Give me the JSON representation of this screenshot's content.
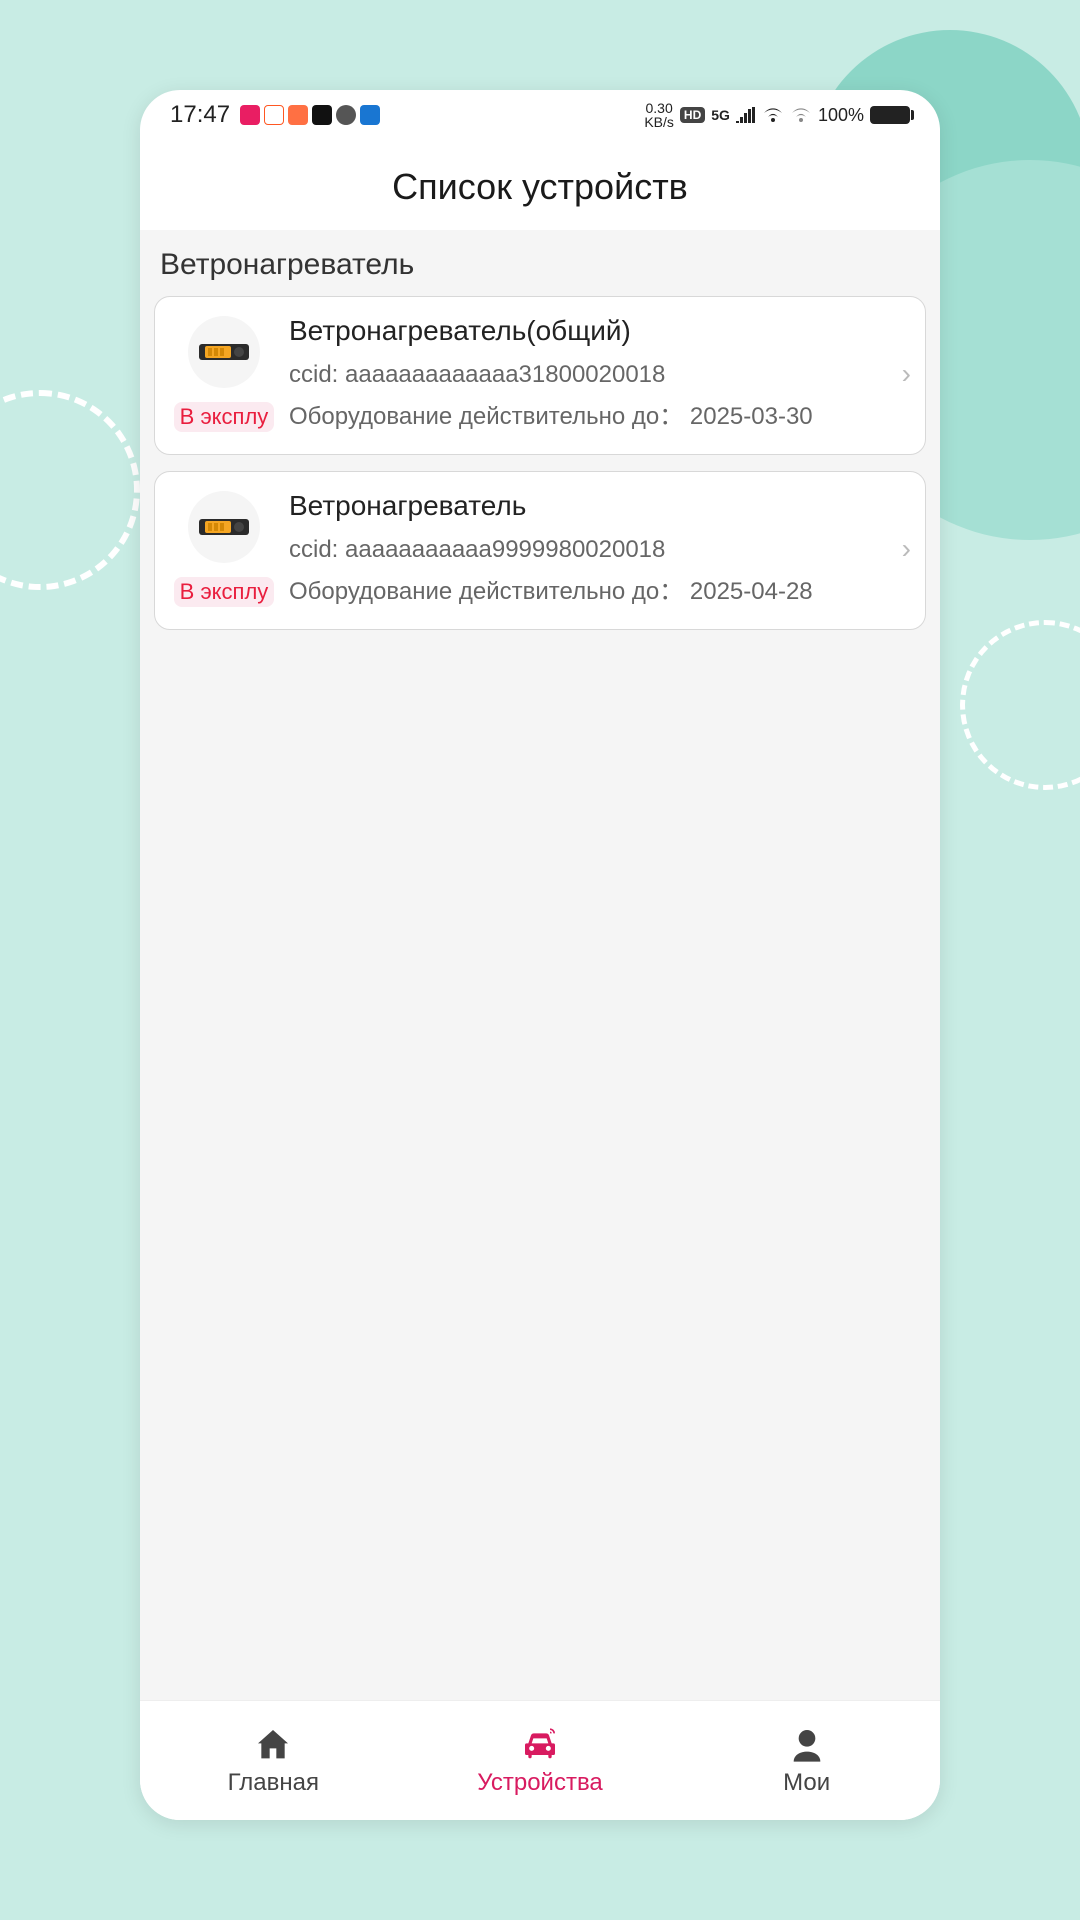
{
  "status_bar": {
    "time": "17:47",
    "net_speed_top": "0.30",
    "net_speed_bottom": "KB/s",
    "hd": "HD",
    "network": "5G",
    "battery": "100%"
  },
  "page_title": "Список устройств",
  "section_title": "Ветронагреватель",
  "devices": [
    {
      "name": "Ветронагреватель(общий)",
      "ccid_label": "ccid:",
      "ccid": "aaaaaaaaaaaaa31800020018",
      "valid_label": "Оборудование действительно до：",
      "valid_date": "2025-03-30",
      "status": "В эксплу"
    },
    {
      "name": "Ветронагреватель",
      "ccid_label": "ccid:",
      "ccid": "aaaaaaaaaaa9999980020018",
      "valid_label": "Оборудование действительно до：",
      "valid_date": "2025-04-28",
      "status": "В эксплу"
    }
  ],
  "nav": {
    "home": "Главная",
    "devices": "Устройства",
    "profile": "Мои"
  }
}
